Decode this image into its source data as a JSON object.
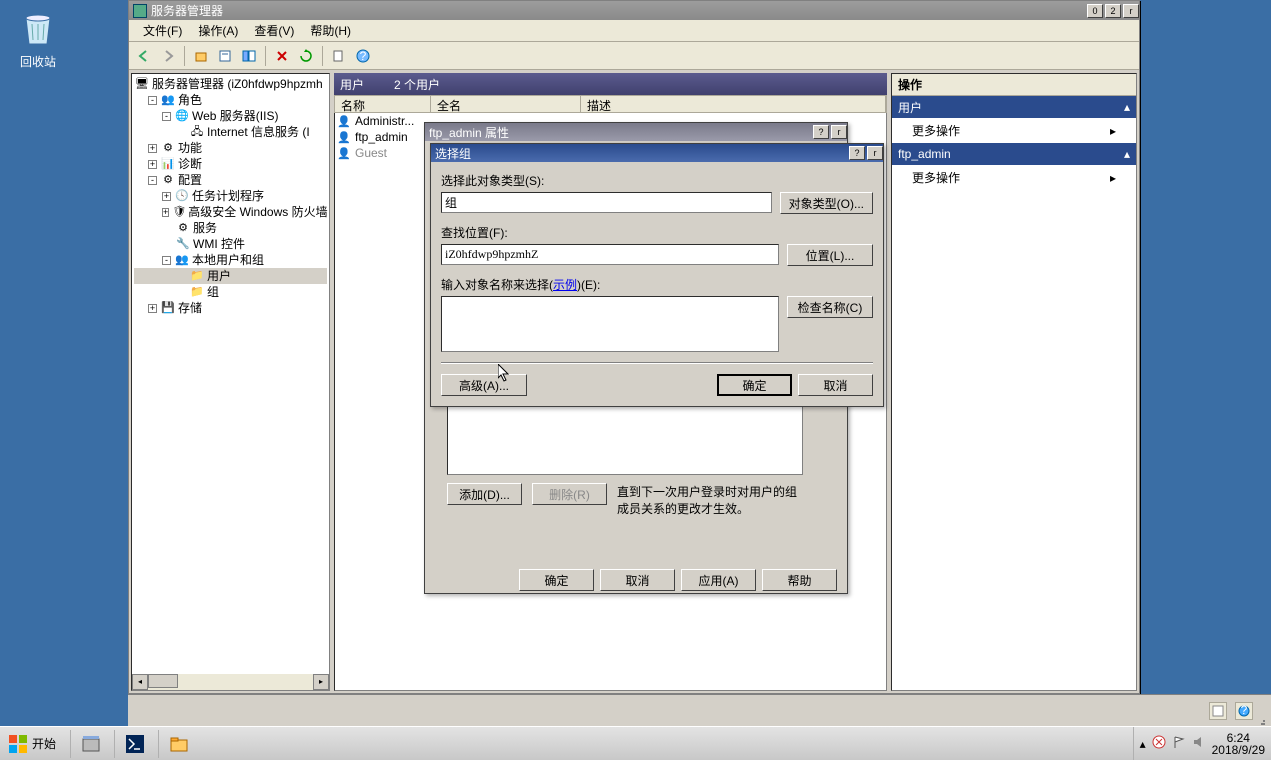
{
  "desktop": {
    "recycle_bin": "回收站"
  },
  "window": {
    "title": "服务器管理器",
    "menu": {
      "file": "文件(F)",
      "action": "操作(A)",
      "view": "查看(V)",
      "help": "帮助(H)"
    }
  },
  "tree": {
    "root": "服务器管理器 (iZ0hfdwp9hpzmh",
    "roles": "角色",
    "web_iis": "Web 服务器(IIS)",
    "iis_info": "Internet 信息服务 (I",
    "features": "功能",
    "diagnostics": "诊断",
    "config": "配置",
    "task_sched": "任务计划程序",
    "adv_firewall": "高级安全 Windows 防火墙",
    "services": "服务",
    "wmi": "WMI 控件",
    "local_users": "本地用户和组",
    "users": "用户",
    "groups": "组",
    "storage": "存储"
  },
  "list": {
    "header_title": "用户",
    "header_count": "2 个用户",
    "col_name": "名称",
    "col_fullname": "全名",
    "col_desc": "描述",
    "rows": [
      {
        "name": "Administr..."
      },
      {
        "name": "ftp_admin"
      },
      {
        "name": "Guest"
      }
    ]
  },
  "actions": {
    "title": "操作",
    "section1": "用户",
    "more1": "更多操作",
    "section2": "ftp_admin",
    "more2": "更多操作"
  },
  "props_dialog": {
    "title": "ftp_admin 属性",
    "note": "直到下一次用户登录时对用户的组成员关系的更改才生效。",
    "add": "添加(D)...",
    "remove": "删除(R)",
    "ok": "确定",
    "cancel": "取消",
    "apply": "应用(A)",
    "help": "帮助"
  },
  "select_dialog": {
    "title": "选择组",
    "obj_type_label": "选择此对象类型(S):",
    "obj_type_value": "组",
    "obj_type_btn": "对象类型(O)...",
    "location_label": "查找位置(F):",
    "location_value": "iZ0hfdwp9hpzmhZ",
    "location_btn": "位置(L)...",
    "names_label_pre": "输入对象名称来选择(",
    "names_label_link": "示例",
    "names_label_post": ")(E):",
    "check_names": "检查名称(C)",
    "advanced": "高级(A)...",
    "ok": "确定",
    "cancel": "取消"
  },
  "taskbar": {
    "start": "开始",
    "time": "6:24",
    "date": "2018/9/29"
  }
}
